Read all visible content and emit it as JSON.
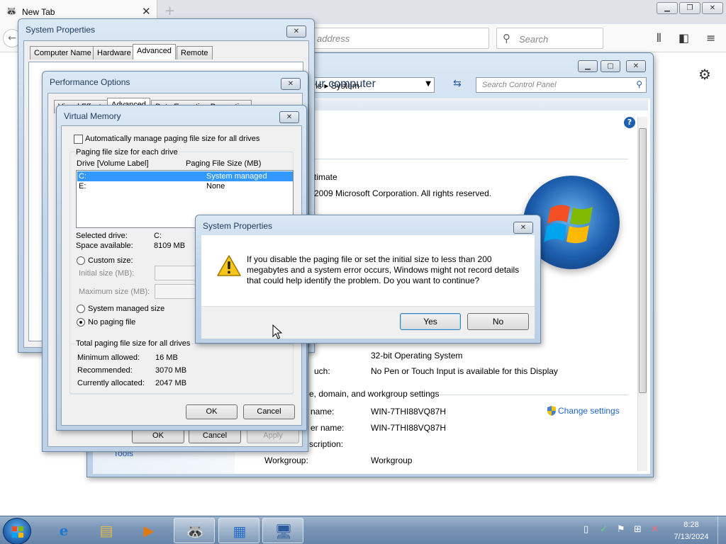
{
  "firefox": {
    "tab_title": "New Tab",
    "tab_close": "✕",
    "new_tab": "+",
    "url_placeholder": "address",
    "search_placeholder": "Search",
    "window_buttons": [
      "▁",
      "❐",
      "✕"
    ]
  },
  "control_panel": {
    "breadcrumb_prefix": "ms",
    "breadcrumb_current": "System",
    "search_placeholder": "Search Control Panel",
    "heading": "formation about your computer",
    "edition": "timate",
    "copyright": "2009 Microsoft Corporation.  All rights reserved.",
    "system_type_value": "32-bit Operating System",
    "pen_label": "uch:",
    "pen_value": "No Pen or Touch Input is available for this Display",
    "section_domain": "e, domain, and workgroup settings",
    "computer_name_label": "name:",
    "computer_name_value": "WIN-7THI88VQ87H",
    "full_name_label": "er name:",
    "full_name_value": "WIN-7THI88VQ87H",
    "description_label": "scription:",
    "workgroup_label": "Workgroup:",
    "workgroup_value": "Workgroup",
    "change_settings": "Change settings",
    "see_also_tools": "Tools"
  },
  "system_properties": {
    "title": "System Properties",
    "tabs": [
      "Computer Name",
      "Hardware",
      "Advanced",
      "Remote"
    ],
    "active_tab": "Advanced"
  },
  "performance_options": {
    "title": "Performance Options",
    "tabs": [
      "Visual Effects",
      "Advanced",
      "Data Execution Prevention"
    ],
    "ok": "OK",
    "cancel": "Cancel",
    "apply": "Apply"
  },
  "virtual_memory": {
    "title": "Virtual Memory",
    "auto_manage": "Automatically manage paging file size for all drives",
    "group_label": "Paging file size for each drive",
    "col_drive": "Drive  [Volume Label]",
    "col_size": "Paging File Size (MB)",
    "drives": [
      {
        "drive": "C:",
        "size": "System managed"
      },
      {
        "drive": "E:",
        "size": "None"
      }
    ],
    "selected_drive_label": "Selected drive:",
    "selected_drive_value": "C:",
    "space_label": "Space available:",
    "space_value": "8109 MB",
    "custom_size": "Custom size:",
    "initial_size": "Initial size (MB):",
    "maximum_size": "Maximum size (MB):",
    "system_managed": "System managed size",
    "no_paging": "No paging file",
    "total_group": "Total paging file size for all drives",
    "minimum_label": "Minimum allowed:",
    "minimum_value": "16 MB",
    "recommended_label": "Recommended:",
    "recommended_value": "3070 MB",
    "allocated_label": "Currently allocated:",
    "allocated_value": "2047 MB",
    "ok": "OK",
    "cancel": "Cancel"
  },
  "confirm_dialog": {
    "title": "System Properties",
    "message": "If you disable the paging file or set the initial size to less than 200 megabytes and a system error occurs, Windows might not record details that could help identify the problem. Do you want to continue?",
    "yes": "Yes",
    "no": "No"
  },
  "taskbar": {
    "time": "8:28",
    "date": "7/13/2024"
  },
  "colors": {
    "accent": "#3399ff",
    "link": "#1e64c8",
    "title_text": "#1e395b"
  }
}
